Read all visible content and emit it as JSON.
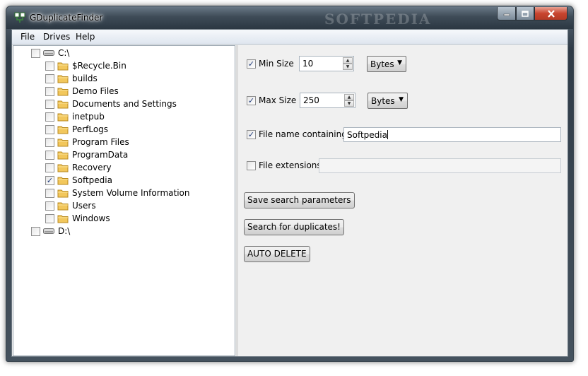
{
  "window": {
    "title": "GDuplicateFinder",
    "watermark": "SOFTPEDIA"
  },
  "menu": [
    "File",
    "Drives",
    "Help"
  ],
  "tree": {
    "drives": [
      {
        "label": "C:\\",
        "checked": false,
        "folders": [
          {
            "label": "$Recycle.Bin",
            "checked": false
          },
          {
            "label": "builds",
            "checked": false
          },
          {
            "label": "Demo Files",
            "checked": false
          },
          {
            "label": "Documents and Settings",
            "checked": false
          },
          {
            "label": "inetpub",
            "checked": false
          },
          {
            "label": "PerfLogs",
            "checked": false
          },
          {
            "label": "Program Files",
            "checked": false
          },
          {
            "label": "ProgramData",
            "checked": false
          },
          {
            "label": "Recovery",
            "checked": false
          },
          {
            "label": "Softpedia",
            "checked": true
          },
          {
            "label": "System Volume Information",
            "checked": false
          },
          {
            "label": "Users",
            "checked": false
          },
          {
            "label": "Windows",
            "checked": false
          }
        ]
      },
      {
        "label": "D:\\",
        "checked": false,
        "folders": []
      }
    ]
  },
  "options": {
    "min_size": {
      "label": "Min Size",
      "checked": true,
      "value": "10",
      "unit": "Bytes"
    },
    "max_size": {
      "label": "Max Size",
      "checked": true,
      "value": "250",
      "unit": "Bytes"
    },
    "name_contains": {
      "label": "File name containing",
      "checked": true,
      "value": "Softpedia"
    },
    "extensions": {
      "label": "File extensions",
      "checked": false,
      "value": ""
    }
  },
  "buttons": {
    "save": "Save search parameters",
    "search": "Search for duplicates!",
    "auto_delete": "AUTO DELETE"
  },
  "check_glyph": "✓"
}
